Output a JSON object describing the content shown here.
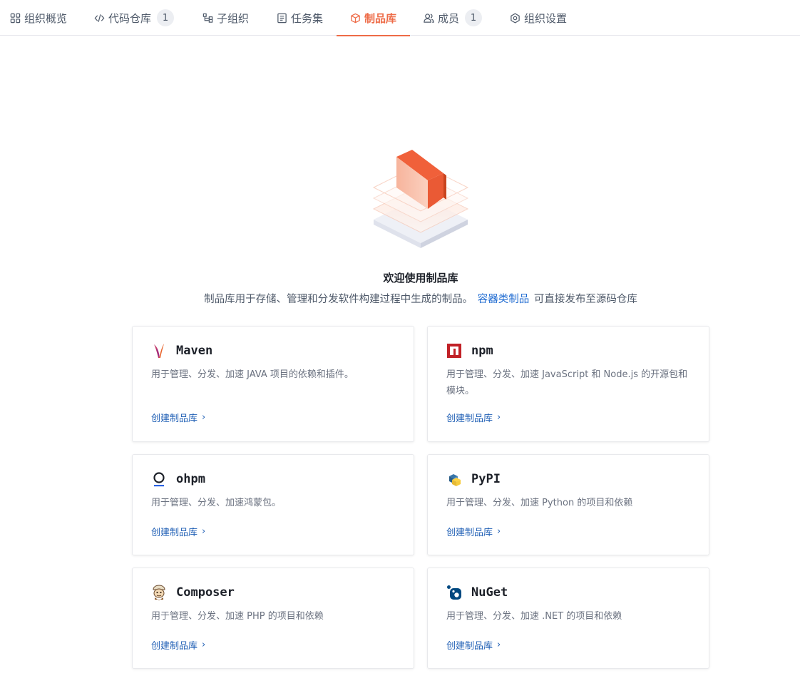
{
  "tabs": [
    {
      "label": "组织概览",
      "icon": "grid-icon",
      "badge": null
    },
    {
      "label": "代码仓库",
      "icon": "code-icon",
      "badge": "1"
    },
    {
      "label": "子组织",
      "icon": "sub-org-icon",
      "badge": null
    },
    {
      "label": "任务集",
      "icon": "task-list-icon",
      "badge": null
    },
    {
      "label": "制品库",
      "icon": "package-icon",
      "badge": null,
      "active": true
    },
    {
      "label": "成员",
      "icon": "members-icon",
      "badge": "1"
    },
    {
      "label": "组织设置",
      "icon": "settings-icon",
      "badge": null
    }
  ],
  "accent_color": "#ee6b47",
  "link_color": "#1f6bd1",
  "welcome": {
    "title": "欢迎使用制品库",
    "desc_prefix": "制品库用于存储、管理和分发软件构建过程中生成的制品。",
    "desc_link": "容器类制品",
    "desc_suffix": "可直接发布至源码仓库"
  },
  "cards": [
    {
      "name": "Maven",
      "icon": "maven-feather-icon",
      "desc": "用于管理、分发、加速 JAVA 项目的依赖和插件。",
      "link": "创建制品库"
    },
    {
      "name": "npm",
      "icon": "npm-icon",
      "desc": "用于管理、分发、加速 JavaScript 和 Node.js 的开源包和模块。",
      "link": "创建制品库"
    },
    {
      "name": "ohpm",
      "icon": "ohpm-icon",
      "desc": "用于管理、分发、加速鸿蒙包。",
      "link": "创建制品库"
    },
    {
      "name": "PyPI",
      "icon": "pypi-icon",
      "desc": "用于管理、分发、加速 Python 的项目和依赖",
      "link": "创建制品库"
    },
    {
      "name": "Composer",
      "icon": "composer-icon",
      "desc": "用于管理、分发、加速 PHP 的项目和依赖",
      "link": "创建制品库"
    },
    {
      "name": "NuGet",
      "icon": "nuget-icon",
      "desc": "用于管理、分发、加速 .NET 的项目和依赖",
      "link": "创建制品库"
    }
  ]
}
